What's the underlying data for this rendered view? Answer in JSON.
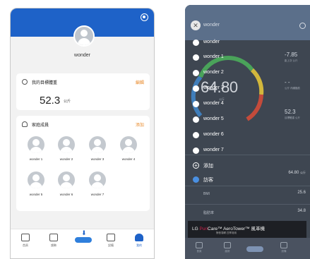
{
  "left": {
    "username": "wonder",
    "goal": {
      "title": "我的目標體重",
      "action": "編輯",
      "value": "52.3",
      "unit": "公斤"
    },
    "family": {
      "title": "家庭成員",
      "action": "添加",
      "members": [
        "wonder 1",
        "wonder 2",
        "wonder 3",
        "wonder 4",
        "wonder 5",
        "wonder 6",
        "wonder 7"
      ]
    },
    "nav": [
      "首頁",
      "趨勢",
      "",
      "設備",
      "我的"
    ],
    "accent": "#1e62c8"
  },
  "right": {
    "title": "wonder",
    "gauge": {
      "value": "64.80",
      "unit": "公斤"
    },
    "side_stats": [
      {
        "value": "-7.85",
        "caption": "距上次 公斤"
      },
      {
        "value": "- -",
        "caption": "公斤 內臟脂肪"
      },
      {
        "value": "52.3",
        "caption": "目標體重 公斤"
      }
    ],
    "rows": [
      {
        "label": "",
        "value": "64.80",
        "unit": "公斤"
      },
      {
        "label": "BMI",
        "value": "25.6"
      },
      {
        "label": "脂肪率",
        "value": "34.8"
      }
    ],
    "banner": {
      "brand": "LG",
      "pure": "Puri",
      "rest": "Care™ AeroTower™ 風革機",
      "sub": "靜音運轉 四季適用"
    },
    "nav": [
      "首頁",
      "趨勢",
      "",
      "設備",
      "我的"
    ]
  },
  "overlay": {
    "items": [
      "wonder",
      "wonder 1",
      "wonder 2",
      "wonder 3",
      "wonder 4",
      "wonder 5",
      "wonder 6",
      "wonder 7"
    ],
    "add_label": "添加",
    "visitor_label": "訪客"
  }
}
